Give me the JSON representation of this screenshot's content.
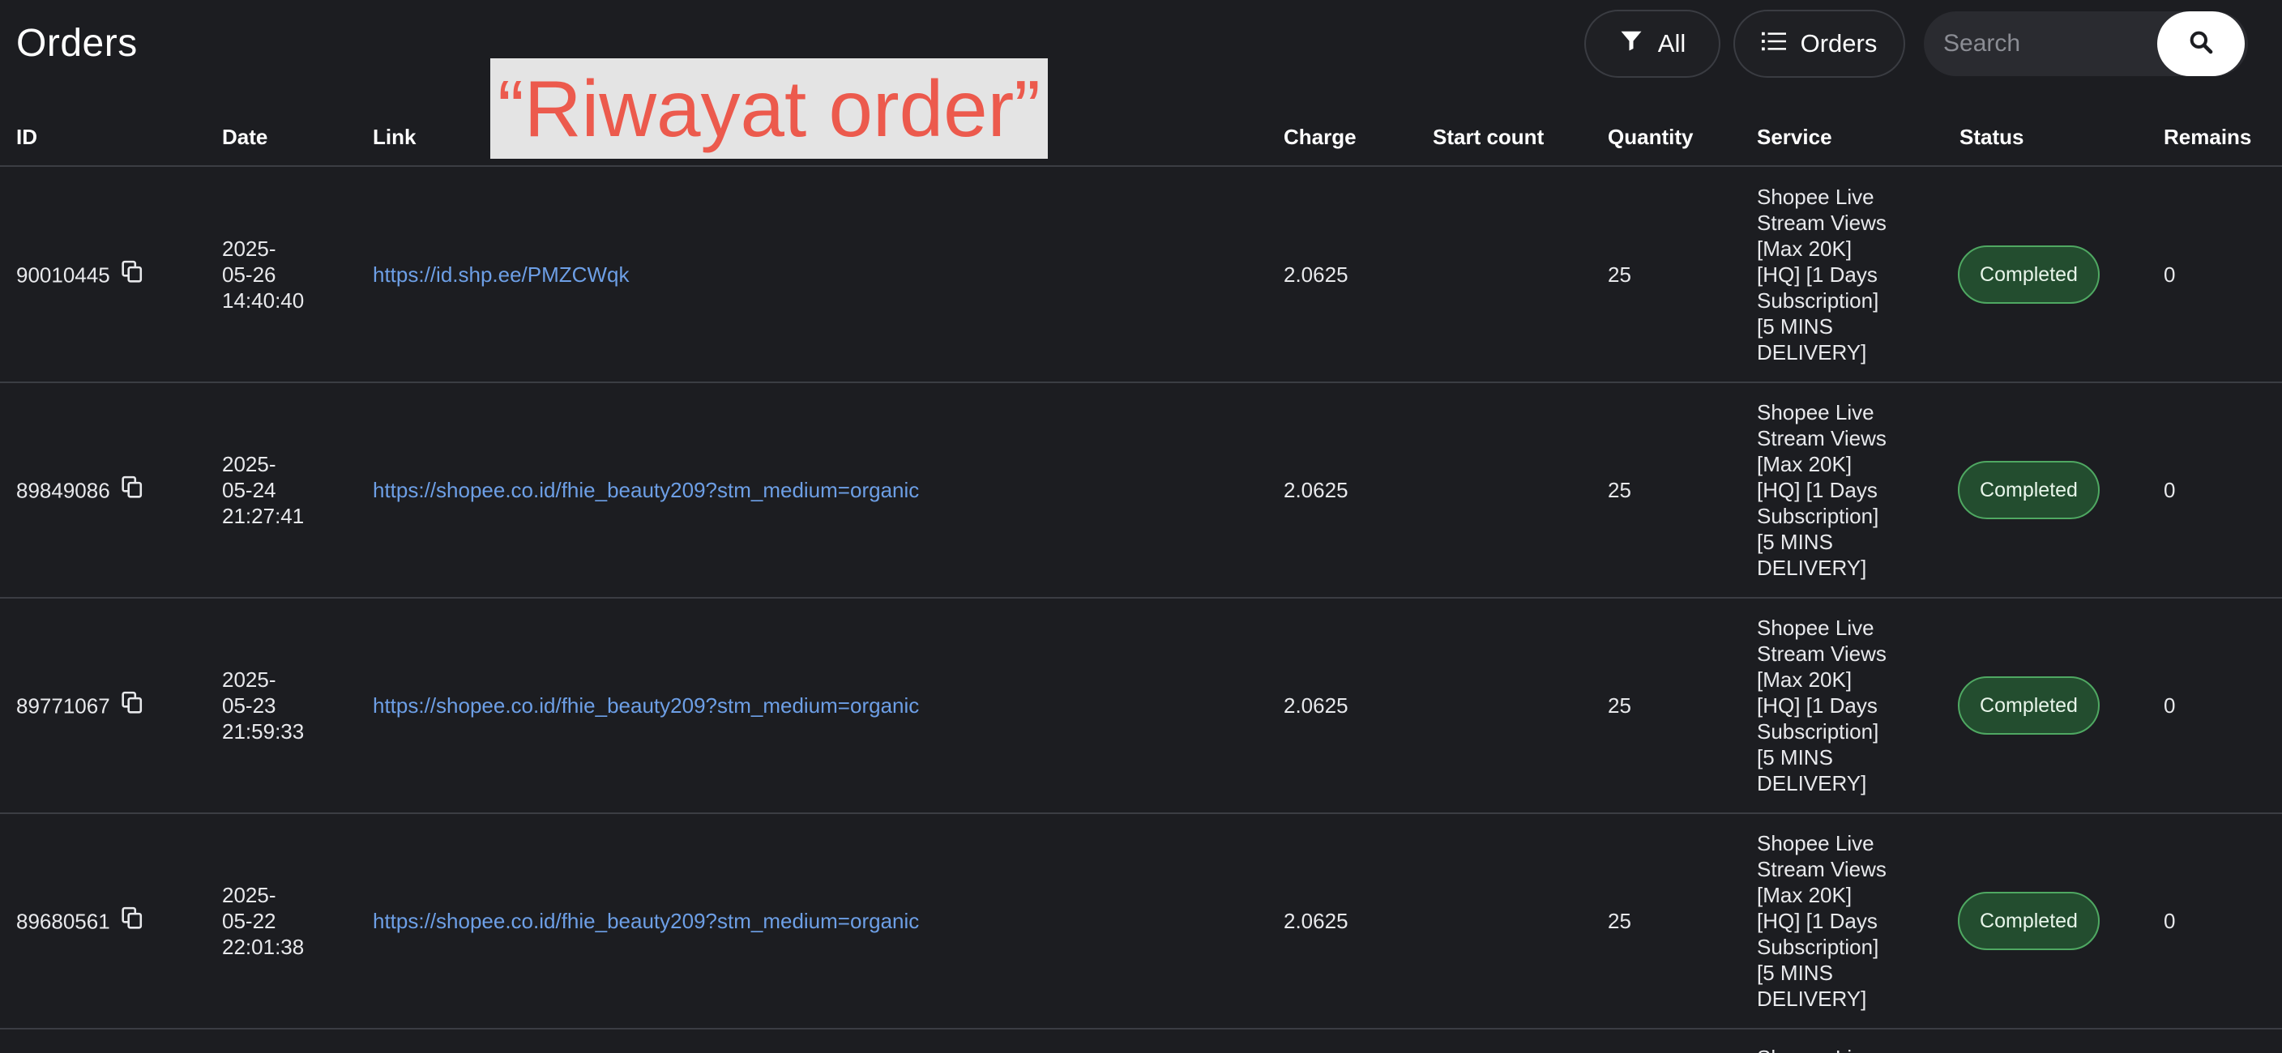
{
  "header": {
    "title": "Orders",
    "filter_label": "All",
    "view_label": "Orders",
    "search_placeholder": "Search"
  },
  "overlay_label": "“Riwayat order”",
  "columns": {
    "id": "ID",
    "date": "Date",
    "link": "Link",
    "charge": "Charge",
    "start_count": "Start count",
    "quantity": "Quantity",
    "service": "Service",
    "status": "Status",
    "remains": "Remains"
  },
  "rows": [
    {
      "id": "90010445",
      "date_line1": "2025-",
      "date_line2": "05-26",
      "date_line3": "14:40:40",
      "link": "https://id.shp.ee/PMZCWqk",
      "charge": "2.0625",
      "start_count": "",
      "quantity": "25",
      "service_lines": [
        "Shopee Live",
        "Stream Views",
        "[Max 20K]",
        "[HQ] [1 Days",
        "Subscription]",
        "[5 MINS",
        "DELIVERY]"
      ],
      "status": "Completed",
      "remains": "0"
    },
    {
      "id": "89849086",
      "date_line1": "2025-",
      "date_line2": "05-24",
      "date_line3": "21:27:41",
      "link": "https://shopee.co.id/fhie_beauty209?stm_medium=organic",
      "charge": "2.0625",
      "start_count": "",
      "quantity": "25",
      "service_lines": [
        "Shopee Live",
        "Stream Views",
        "[Max 20K]",
        "[HQ] [1 Days",
        "Subscription]",
        "[5 MINS",
        "DELIVERY]"
      ],
      "status": "Completed",
      "remains": "0"
    },
    {
      "id": "89771067",
      "date_line1": "2025-",
      "date_line2": "05-23",
      "date_line3": "21:59:33",
      "link": "https://shopee.co.id/fhie_beauty209?stm_medium=organic",
      "charge": "2.0625",
      "start_count": "",
      "quantity": "25",
      "service_lines": [
        "Shopee Live",
        "Stream Views",
        "[Max 20K]",
        "[HQ] [1 Days",
        "Subscription]",
        "[5 MINS",
        "DELIVERY]"
      ],
      "status": "Completed",
      "remains": "0"
    },
    {
      "id": "89680561",
      "date_line1": "2025-",
      "date_line2": "05-22",
      "date_line3": "22:01:38",
      "link": "https://shopee.co.id/fhie_beauty209?stm_medium=organic",
      "charge": "2.0625",
      "start_count": "",
      "quantity": "25",
      "service_lines": [
        "Shopee Live",
        "Stream Views",
        "[Max 20K]",
        "[HQ] [1 Days",
        "Subscription]",
        "[5 MINS",
        "DELIVERY]"
      ],
      "status": "Completed",
      "remains": "0"
    }
  ],
  "partial_row": {
    "service_line1": "Shopee Live"
  },
  "icons": {
    "filter": "filter-icon",
    "list": "list-icon",
    "search": "search-icon",
    "copy": "copy-icon"
  },
  "colors": {
    "background": "#1c1d21",
    "link": "#6d9fe6",
    "status_completed_bg": "#234d2f",
    "status_completed_border": "#4fa862",
    "overlay_text": "#ec5a4d"
  }
}
